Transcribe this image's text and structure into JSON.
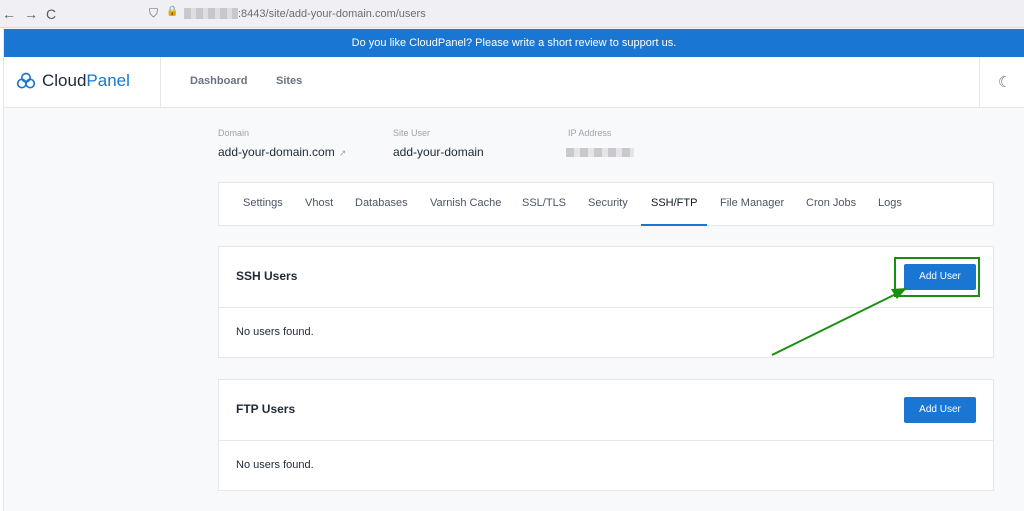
{
  "browser": {
    "back": "←",
    "forward": "→",
    "reload": "C",
    "shield": "⛉",
    "lock": "🔒",
    "url": ":8443/site/add-your-domain.com/users"
  },
  "banner": {
    "text": "Do you like CloudPanel? Please write a short review to support us."
  },
  "header": {
    "logo_part1": "Cloud",
    "logo_part2": "Panel",
    "nav": [
      "Dashboard",
      "Sites"
    ],
    "theme_icon": "☾"
  },
  "site": {
    "domain_label": "Domain",
    "domain_value": "add-your-domain.com",
    "user_label": "Site User",
    "user_value": "add-your-domain",
    "ip_label": "IP Address"
  },
  "tabs": [
    "Settings",
    "Vhost",
    "Databases",
    "Varnish Cache",
    "SSL/TLS",
    "Security",
    "SSH/FTP",
    "File Manager",
    "Cron Jobs",
    "Logs"
  ],
  "active_tab": "SSH/FTP",
  "ssh": {
    "title": "SSH Users",
    "button": "Add User",
    "empty": "No users found."
  },
  "ftp": {
    "title": "FTP Users",
    "button": "Add User",
    "empty": "No users found."
  },
  "colors": {
    "accent": "#1976d2",
    "annotation": "#1a8f0f"
  }
}
